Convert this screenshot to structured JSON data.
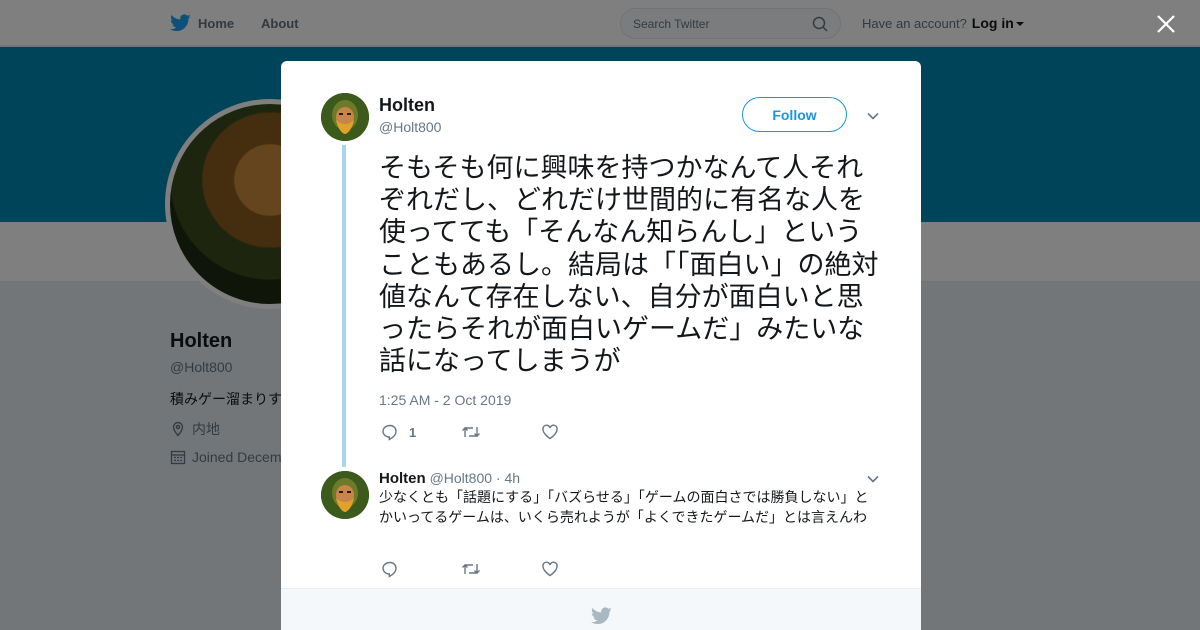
{
  "nav": {
    "home_label": "Home",
    "about_label": "About"
  },
  "search": {
    "placeholder": "Search Twitter"
  },
  "account": {
    "prompt": "Have an account?",
    "login_label": "Log in"
  },
  "profile": {
    "name": "Holten",
    "handle": "@Holt800",
    "bio": "積みゲー溜まりす",
    "location": "内地",
    "joined": "Joined Decem"
  },
  "tweet": {
    "author_name": "Holten",
    "author_handle": "@Holt800",
    "follow_label": "Follow",
    "text": "そもそも何に興味を持つかなんて人それぞれだし、どれだけ世間的に有名な人を使ってても「そんなん知らんし」ということもあるし。結局は「「面白い」の絶対値なんて存在しない、自分が面白いと思ったらそれが面白いゲームだ」みたいな話になってしまうが",
    "timestamp": "1:25 AM - 2 Oct 2019",
    "reply_count": "1"
  },
  "reply": {
    "author_name": "Holten",
    "author_handle": "@Holt800",
    "time": "· 4h",
    "text": "少なくとも「話題にする」「バズらせる」「ゲームの面白さでは勝負しない」とかいってるゲームは、いくら売れようが「よくできたゲームだ」とは言えんわ"
  },
  "colors": {
    "accent": "#1b95e0",
    "banner": "#0089b3",
    "thread_line": "#a7d8f0",
    "secondary_text": "#657786"
  }
}
